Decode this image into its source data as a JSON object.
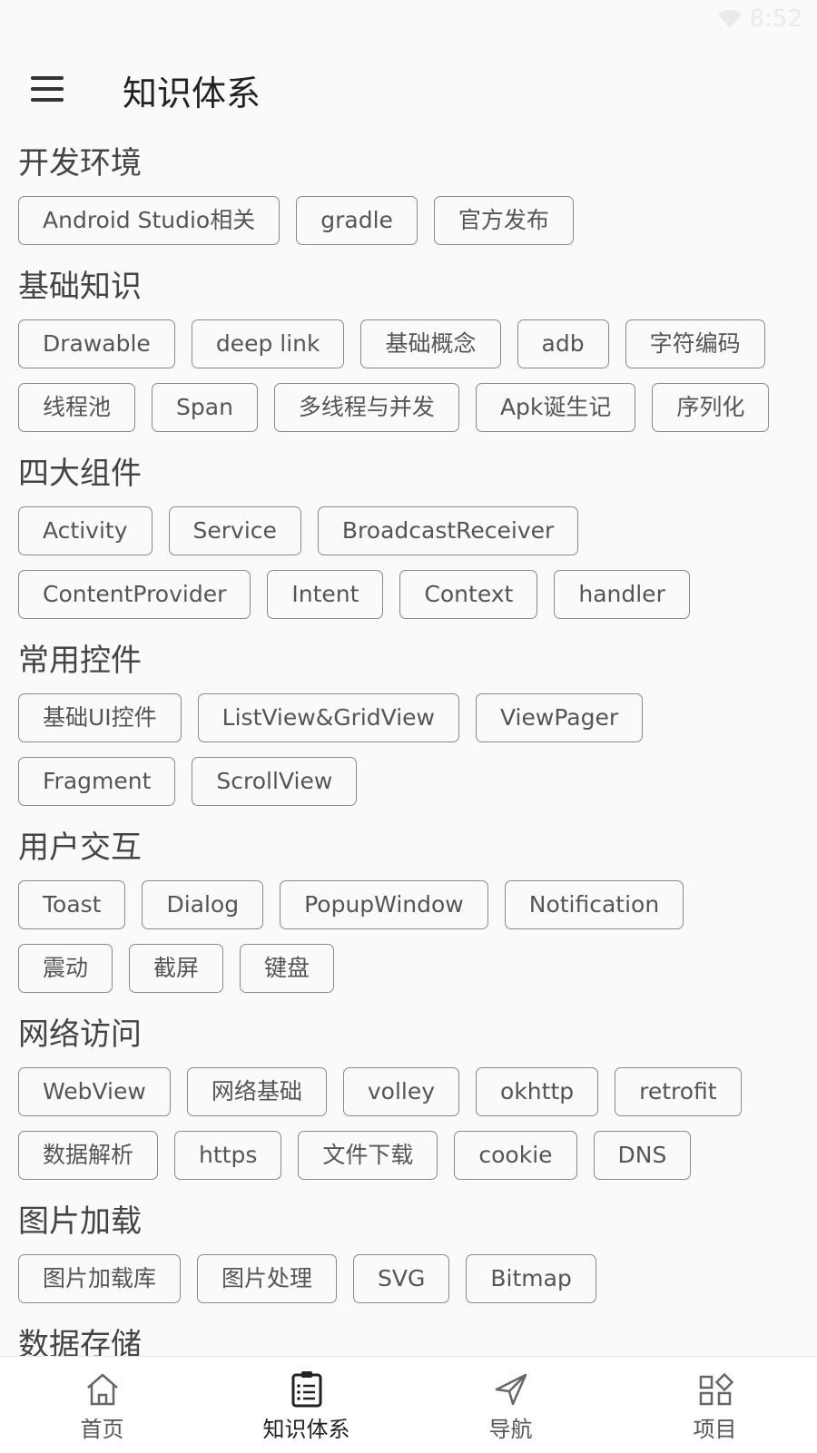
{
  "status_bar": {
    "time": "8:52"
  },
  "app_bar": {
    "title": "知识体系"
  },
  "sections": [
    {
      "title": "开发环境",
      "chips": [
        "Android Studio相关",
        "gradle",
        "官方发布"
      ]
    },
    {
      "title": "基础知识",
      "chips": [
        "Drawable",
        "deep link",
        "基础概念",
        "adb",
        "字符编码",
        "线程池",
        "Span",
        "多线程与并发",
        "Apk诞生记",
        "序列化"
      ]
    },
    {
      "title": "四大组件",
      "chips": [
        "Activity",
        "Service",
        "BroadcastReceiver",
        "ContentProvider",
        "Intent",
        "Context",
        "handler"
      ]
    },
    {
      "title": "常用控件",
      "chips": [
        "基础UI控件",
        "ListView&GridView",
        "ViewPager",
        "Fragment",
        "ScrollView"
      ]
    },
    {
      "title": "用户交互",
      "chips": [
        "Toast",
        "Dialog",
        "PopupWindow",
        "Notification",
        "震动",
        "截屏",
        "键盘"
      ]
    },
    {
      "title": "网络访问",
      "chips": [
        "WebView",
        "网络基础",
        "volley",
        "okhttp",
        "retrofit",
        "数据解析",
        "https",
        "文件下载",
        "cookie",
        "DNS"
      ]
    },
    {
      "title": "图片加载",
      "chips": [
        "图片加载库",
        "图片处理",
        "SVG",
        "Bitmap"
      ]
    },
    {
      "title": "数据存储",
      "chips": []
    }
  ],
  "bottom_nav": [
    {
      "label": "首页",
      "icon": "home-icon"
    },
    {
      "label": "知识体系",
      "icon": "clipboard-list-icon",
      "active": true
    },
    {
      "label": "导航",
      "icon": "send-icon"
    },
    {
      "label": "项目",
      "icon": "grid-icon"
    }
  ]
}
